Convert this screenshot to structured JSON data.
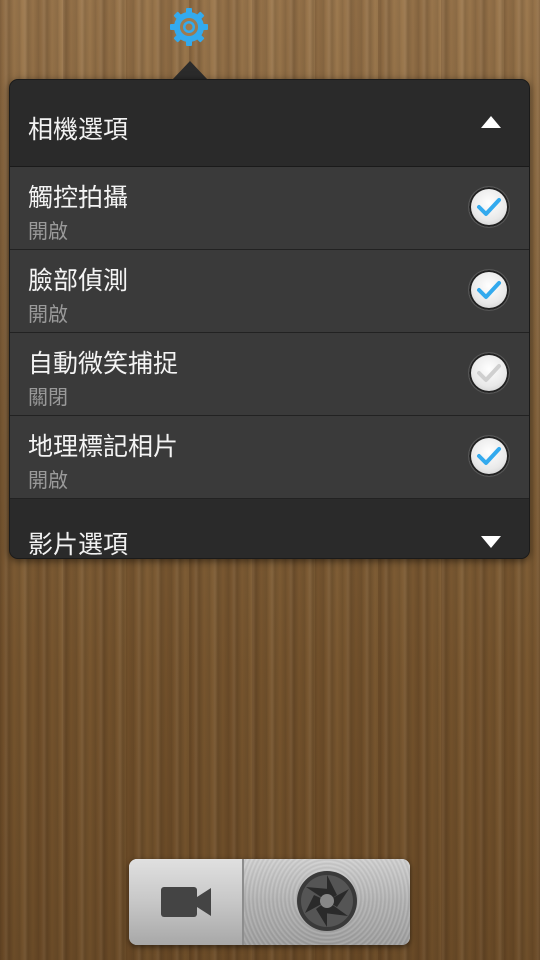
{
  "colors": {
    "accent": "#33aaee",
    "panel": "#2b2b2b",
    "item": "#3a3a3a",
    "subtext": "#9a9a9a"
  },
  "top": {
    "gear_icon": "gear-icon"
  },
  "panel": {
    "header": {
      "title": "相機選項",
      "icon": "chevron-up-icon"
    },
    "items": [
      {
        "label": "觸控拍攝",
        "state": "開啟",
        "checked": true
      },
      {
        "label": "臉部偵測",
        "state": "開啟",
        "checked": true
      },
      {
        "label": "自動微笑捕捉",
        "state": "關閉",
        "checked": false
      },
      {
        "label": "地理標記相片",
        "state": "開啟",
        "checked": true
      }
    ],
    "footer": {
      "title": "影片選項",
      "icon": "chevron-down-icon"
    }
  },
  "bottom_bar": {
    "video_icon": "video-camera-icon",
    "shutter_icon": "camera-shutter-icon"
  }
}
